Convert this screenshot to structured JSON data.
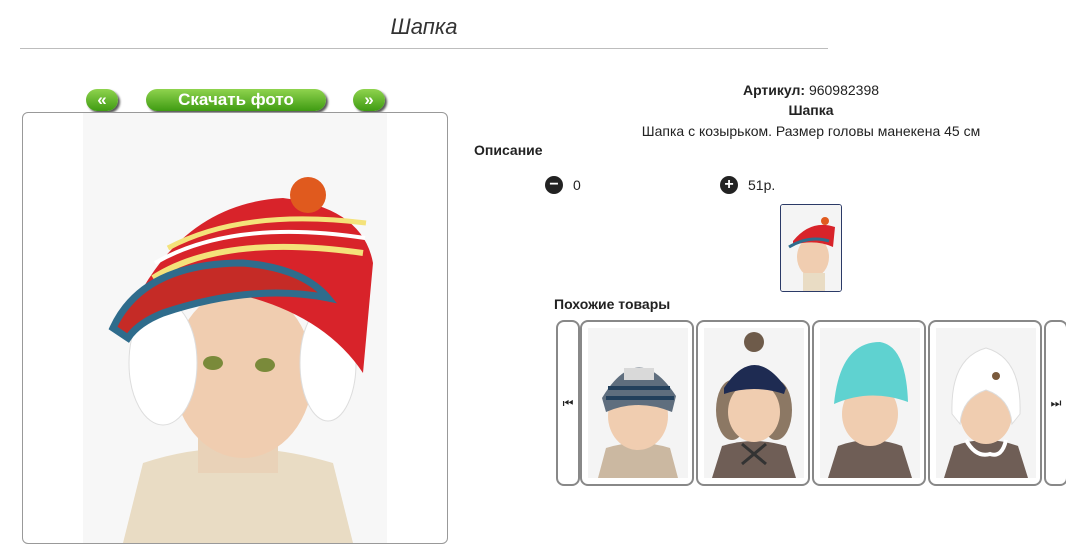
{
  "page": {
    "title": "Шапка"
  },
  "gallery": {
    "prev_label": "«",
    "download_label": "Скачать фото",
    "next_label": "»"
  },
  "product": {
    "article_label": "Артикул:",
    "article_value": "960982398",
    "name": "Шапка",
    "description": "Шапка с козырьком. Размер головы манекена 45 см",
    "description_label": "Описание",
    "quantity": "0",
    "price": "51р."
  },
  "similar": {
    "title": "Похожие товары",
    "items": [
      {
        "hat": "striped-grey-beanie"
      },
      {
        "hat": "navy-pompom-trapper"
      },
      {
        "hat": "turquoise-beanie"
      },
      {
        "hat": "white-earflap-hat"
      }
    ]
  },
  "icons": {
    "minus": "minus-circle-icon",
    "plus": "plus-circle-icon",
    "first": "skip-back-icon",
    "last": "skip-forward-icon"
  },
  "colors": {
    "button_green": "#4aa81a",
    "thumb_border": "#2b3a67"
  }
}
